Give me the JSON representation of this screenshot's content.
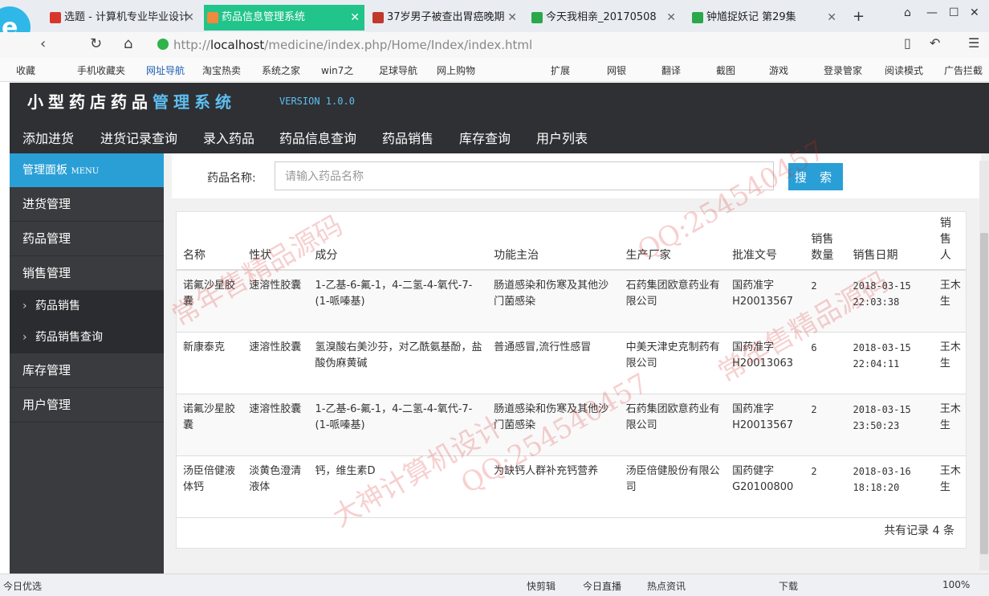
{
  "browser": {
    "tabs": [
      {
        "label": "选题 - 计算机专业毕业设计",
        "icon_color": "#d9362b"
      },
      {
        "label": "药品信息管理系统",
        "icon_color": "#f08a3c"
      },
      {
        "label": "37岁男子被查出胃癌晚期",
        "icon_color": "#c0392b"
      },
      {
        "label": "今天我相亲_20170508",
        "icon_color": "#2aa84a"
      },
      {
        "label": "钟馗捉妖记 第29集",
        "icon_color": "#2aa84a"
      }
    ],
    "new_tab": "+",
    "url_prefix": "http://",
    "url_host": "localhost",
    "url_path": "/medicine/index.php/Home/Index/index.html",
    "bookmarks_left": [
      "收藏",
      "手机收藏夹",
      "网址导航",
      "淘宝热卖",
      "系统之家",
      "win7之",
      "足球导航",
      "网上购物"
    ],
    "bookmarks_right": [
      "扩展",
      "网银",
      "翻译",
      "截图",
      "游戏",
      "登录管家",
      "阅读模式",
      "广告拦截"
    ],
    "status_left": "今日优选",
    "status_right": [
      "快剪辑",
      "今日直播",
      "热点资讯",
      "下载",
      "100%"
    ]
  },
  "app": {
    "title_part1": "小型药店药品",
    "title_part2": "管理系统",
    "version": "VERSION 1.0.0",
    "top_nav": [
      "添加进货",
      "进货记录查询",
      "录入药品",
      "药品信息查询",
      "药品销售",
      "库存查询",
      "用户列表"
    ],
    "sidebar": {
      "header": "管理面板",
      "header_small": "MENU",
      "items": [
        "进货管理",
        "药品管理",
        "销售管理"
      ],
      "sub_items": [
        "药品销售",
        "药品销售查询"
      ],
      "items_after": [
        "库存管理",
        "用户管理"
      ]
    },
    "search": {
      "label": "药品名称:",
      "placeholder": "请输入药品名称",
      "button": "搜 索"
    },
    "table": {
      "headers": [
        "名称",
        "性状",
        "成分",
        "功能主治",
        "生产厂家",
        "批准文号",
        "销售数量",
        "销售日期",
        "销售人"
      ],
      "rows": [
        [
          "诺氟沙星胶囊",
          "速溶性胶囊",
          "1-乙基-6-氟-1，4-二氢-4-氧代-7-(1-哌嗪基)",
          "肠道感染和伤寒及其他沙门菌感染",
          "石药集团欧意药业有限公司",
          "国药准字H20013567",
          "2",
          "2018-03-15 22:03:38",
          "王木生"
        ],
        [
          "新康泰克",
          "速溶性胶囊",
          "氢溴酸右美沙芬，对乙酰氨基酚，盐酸伪麻黄碱",
          "普通感冒,流行性感冒",
          "中美天津史克制药有限公司",
          "国药准字H20013063",
          "6",
          "2018-03-15 22:04:11",
          "王木生"
        ],
        [
          "诺氟沙星胶囊",
          "速溶性胶囊",
          "1-乙基-6-氟-1，4-二氢-4-氧代-7-(1-哌嗪基)",
          "肠道感染和伤寒及其他沙门菌感染",
          "石药集团欧意药业有限公司",
          "国药准字H20013567",
          "2",
          "2018-03-15 23:50:23",
          "王木生"
        ],
        [
          "汤臣倍健液体钙",
          "淡黄色澄清液体",
          "钙，维生素D",
          "为缺钙人群补充钙营养",
          "汤臣倍健股份有限公司",
          "国药健字G20100800",
          "2",
          "2018-03-16 18:18:20",
          "王木生"
        ]
      ],
      "footer": "共有记录 4 条"
    }
  },
  "watermarks": [
    "常年售精品源码",
    "QQ:254540457",
    "大神计算机设计"
  ]
}
